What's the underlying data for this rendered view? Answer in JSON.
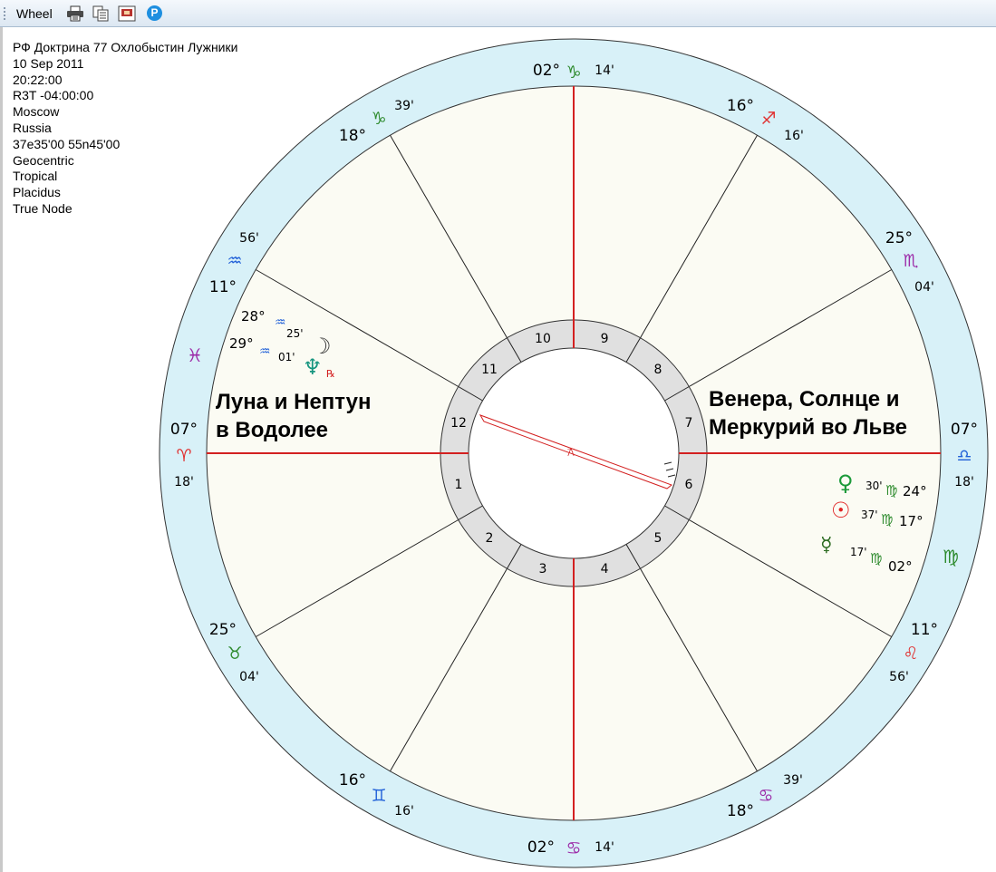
{
  "toolbar": {
    "title": "Wheel",
    "buttons": [
      {
        "name": "print-icon"
      },
      {
        "name": "copy-icon"
      },
      {
        "name": "image-export-icon"
      },
      {
        "name": "p-icon",
        "label": "P"
      }
    ]
  },
  "chart_info": [
    "РФ Доктрина 77 Охлобыстин Лужники",
    "10 Sep 2011",
    "20:22:00",
    "R3T -04:00:00",
    "Moscow",
    "Russia",
    "37e35'00 55n45'00",
    "Geocentric",
    "Tropical",
    "Placidus",
    "True Node"
  ],
  "annotations": {
    "left_line1": "Луна и Нептун",
    "left_line2": "в Водолее",
    "right_line1": "Венера, Солнце и",
    "right_line2": "Меркурий во Льве"
  },
  "colors": {
    "ring": "#d8f1f8",
    "inner_ring": "#e0e0e0",
    "field": "#fbfbf3",
    "axis": "#d32020",
    "fire": "#e03030",
    "earth": "#2e8b2e",
    "air": "#2060d8",
    "water": "#9c2aa8"
  },
  "houses": [
    "1",
    "2",
    "3",
    "4",
    "5",
    "6",
    "7",
    "8",
    "9",
    "10",
    "11",
    "12"
  ],
  "cusps": [
    {
      "name": "asc",
      "deg": "07°",
      "min": "18'",
      "sign": "aries-icon",
      "glyph": "♈",
      "color": "fire"
    },
    {
      "name": "c2",
      "deg": "16°",
      "min": "16'",
      "sign": "gemini-icon",
      "glyph": "♊",
      "color": "air"
    },
    {
      "name": "c3",
      "deg": "25°",
      "min": "04'",
      "sign": "taurus-icon",
      "glyph": "♉",
      "color": "earth"
    },
    {
      "name": "ic",
      "deg": "02°",
      "min": "14'",
      "sign": "cancer-icon",
      "glyph": "♋",
      "color": "water"
    },
    {
      "name": "c5",
      "deg": "11°",
      "min": "56'",
      "sign": "leo-icon",
      "glyph": "♌",
      "color": "fire"
    },
    {
      "name": "c6",
      "deg": "18°",
      "min": "39'",
      "sign": "cancer-icon",
      "glyph": "♋",
      "color": "water"
    },
    {
      "name": "dsc",
      "deg": "07°",
      "min": "18'",
      "sign": "libra-icon",
      "glyph": "♎",
      "color": "air"
    },
    {
      "name": "c8",
      "deg": "25°",
      "min": "04'",
      "sign": "scorpio-icon",
      "glyph": "♏",
      "color": "water"
    },
    {
      "name": "c9",
      "deg": "16°",
      "min": "16'",
      "sign": "sagittarius-icon",
      "glyph": "♐",
      "color": "fire"
    },
    {
      "name": "mc",
      "deg": "02°",
      "min": "14'",
      "sign": "capricorn-icon",
      "glyph": "♑",
      "color": "earth"
    },
    {
      "name": "c11",
      "deg": "18°",
      "min": "39'",
      "sign": "capricorn-icon",
      "glyph": "♑",
      "color": "earth"
    },
    {
      "name": "c12",
      "deg": "11°",
      "min": "56'",
      "sign": "aquarius-icon",
      "glyph": "♒",
      "color": "air"
    }
  ],
  "intercepted": [
    {
      "sign": "pisces-icon",
      "glyph": "♓",
      "color": "water"
    },
    {
      "sign": "virgo-icon",
      "glyph": "♍",
      "color": "earth"
    }
  ],
  "planets": [
    {
      "name": "moon",
      "icon": "moon-icon",
      "glyph": "☽",
      "color": "#333333",
      "deg": "28°",
      "min": "25'",
      "sign_glyph": "♒"
    },
    {
      "name": "neptune",
      "icon": "neptune-icon",
      "glyph": "♆",
      "color": "#16957f",
      "deg": "29°",
      "min": "01'",
      "sign_glyph": "♒",
      "retro": "℞"
    },
    {
      "name": "venus",
      "icon": "venus-icon",
      "glyph": "♀",
      "color": "#1c9a3a",
      "deg": "24°",
      "min": "30'",
      "sign_glyph": "♍"
    },
    {
      "name": "sun",
      "icon": "sun-icon",
      "glyph": "☉",
      "color": "#e02020",
      "deg": "17°",
      "min": "37'",
      "sign_glyph": "♍"
    },
    {
      "name": "mercury",
      "icon": "mercury-icon",
      "glyph": "☿",
      "color": "#2b6b20",
      "deg": "02°",
      "min": "17'",
      "sign_glyph": "♍"
    }
  ],
  "aspect": {
    "glyph": "⚻",
    "color": "#d32020"
  }
}
